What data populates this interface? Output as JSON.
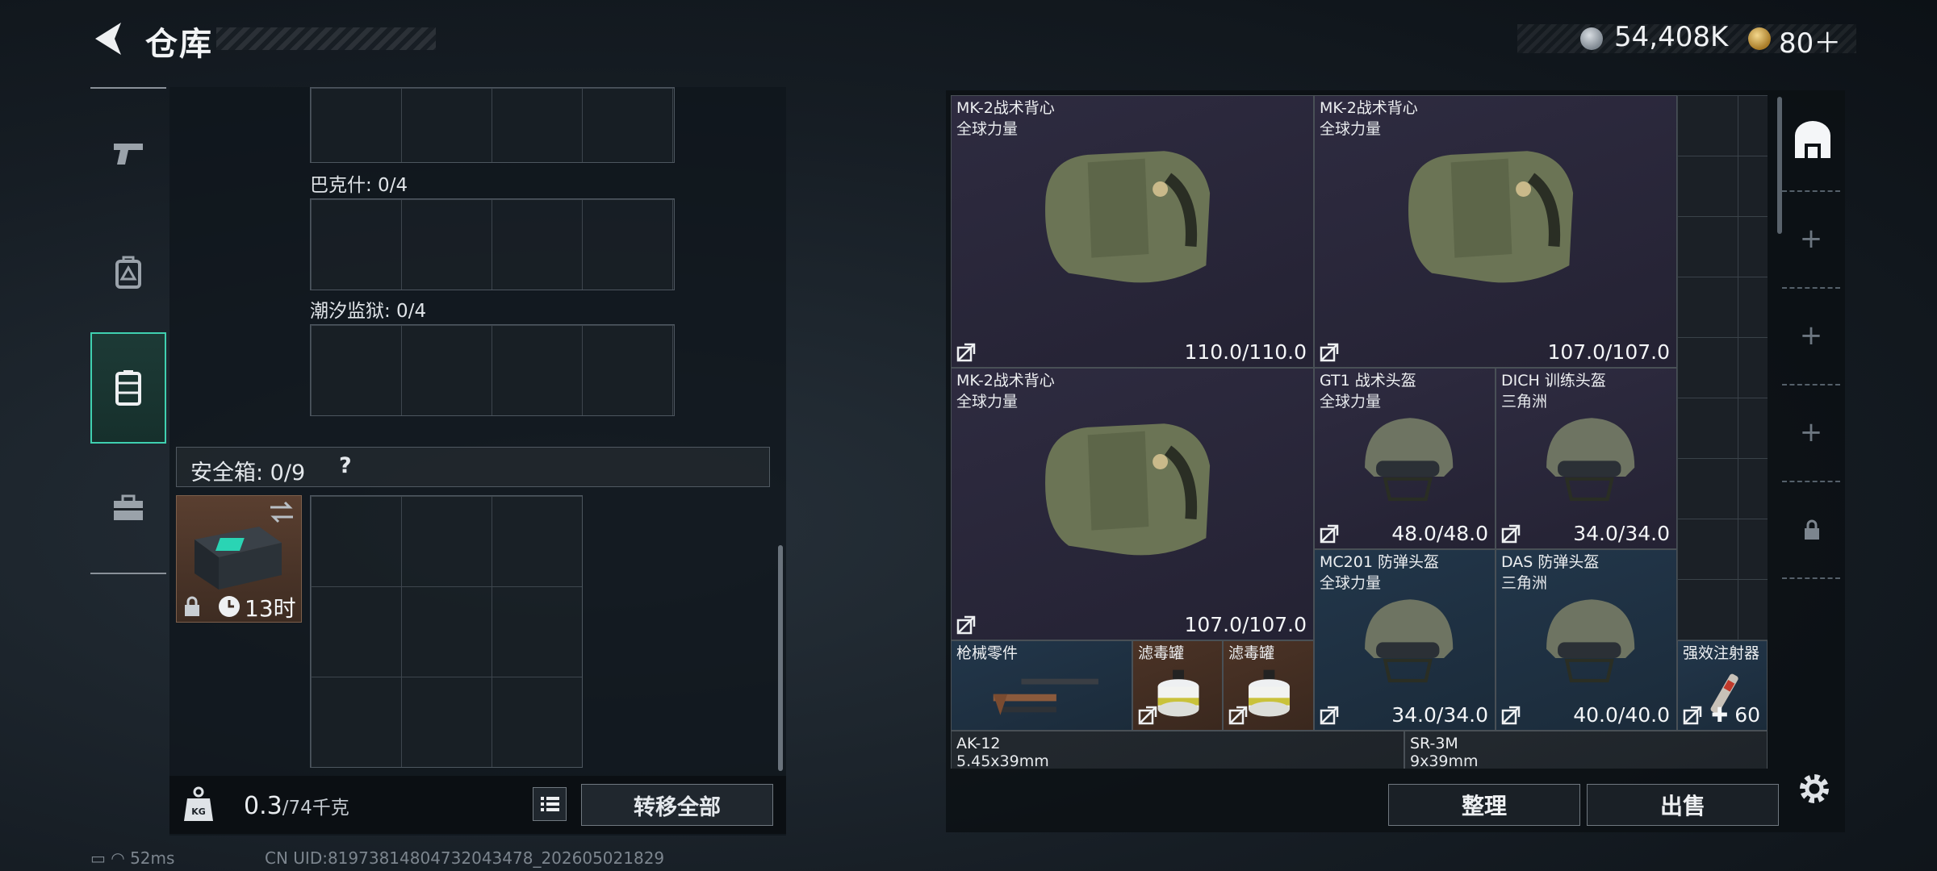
{
  "header": {
    "title": "仓库",
    "money": "54,408K",
    "tokens": "80＋"
  },
  "left": {
    "containers": [
      {
        "label": "巴克什: 0/4"
      },
      {
        "label": "潮汐监狱: 0/4"
      }
    ],
    "safe_box": {
      "label": "安全箱: 0/9",
      "help": "?",
      "timer": "13时"
    },
    "weight": {
      "value": "0.3",
      "unit": "/74千克"
    },
    "transfer_all": "转移全部"
  },
  "stash": {
    "items": [
      {
        "name": "MK-2战术背心",
        "sub": "全球力量",
        "value": "110.0/110.0",
        "rarity": "purple",
        "kind": "vest"
      },
      {
        "name": "MK-2战术背心",
        "sub": "全球力量",
        "value": "107.0/107.0",
        "rarity": "purple",
        "kind": "vest"
      },
      {
        "name": "MK-2战术背心",
        "sub": "全球力量",
        "value": "107.0/107.0",
        "rarity": "purple",
        "kind": "vest"
      },
      {
        "name": "GT1 战术头盔",
        "sub": "全球力量",
        "value": "48.0/48.0",
        "rarity": "purple",
        "kind": "helmet"
      },
      {
        "name": "DICH 训练头盔",
        "sub": "三角洲",
        "value": "34.0/34.0",
        "rarity": "purple",
        "kind": "helmet"
      },
      {
        "name": "MC201 防弹头盔",
        "sub": "全球力量",
        "value": "34.0/34.0",
        "rarity": "blue",
        "kind": "helmet"
      },
      {
        "name": "DAS 防弹头盔",
        "sub": "三角洲",
        "value": "40.0/40.0",
        "rarity": "blue",
        "kind": "helmet"
      },
      {
        "name": "枪械零件",
        "sub": "",
        "value": "",
        "rarity": "blue",
        "kind": "parts"
      },
      {
        "name": "滤毒罐",
        "sub": "",
        "value": "",
        "rarity": "brown",
        "kind": "filter"
      },
      {
        "name": "滤毒罐",
        "sub": "",
        "value": "",
        "rarity": "brown",
        "kind": "filter"
      },
      {
        "name": "强效注射器",
        "sub": "",
        "value": "60",
        "rarity": "blue",
        "kind": "injector"
      },
      {
        "name": "AK-12",
        "sub": "5.45x39mm",
        "value": "",
        "rarity": "gray",
        "kind": "rifle"
      },
      {
        "name": "SR-3M",
        "sub": "9x39mm",
        "value": "",
        "rarity": "gray",
        "kind": "rifle"
      }
    ],
    "sort": "整理",
    "sell": "出售"
  },
  "status": {
    "ping": "52ms",
    "uid": "CN UID:819738148047320434​78_202605021829"
  },
  "colors": {
    "accent": "#3fd0b0",
    "purple_item": "#2e2b40",
    "blue_item": "#22364a",
    "brown_item": "#4b3326"
  }
}
